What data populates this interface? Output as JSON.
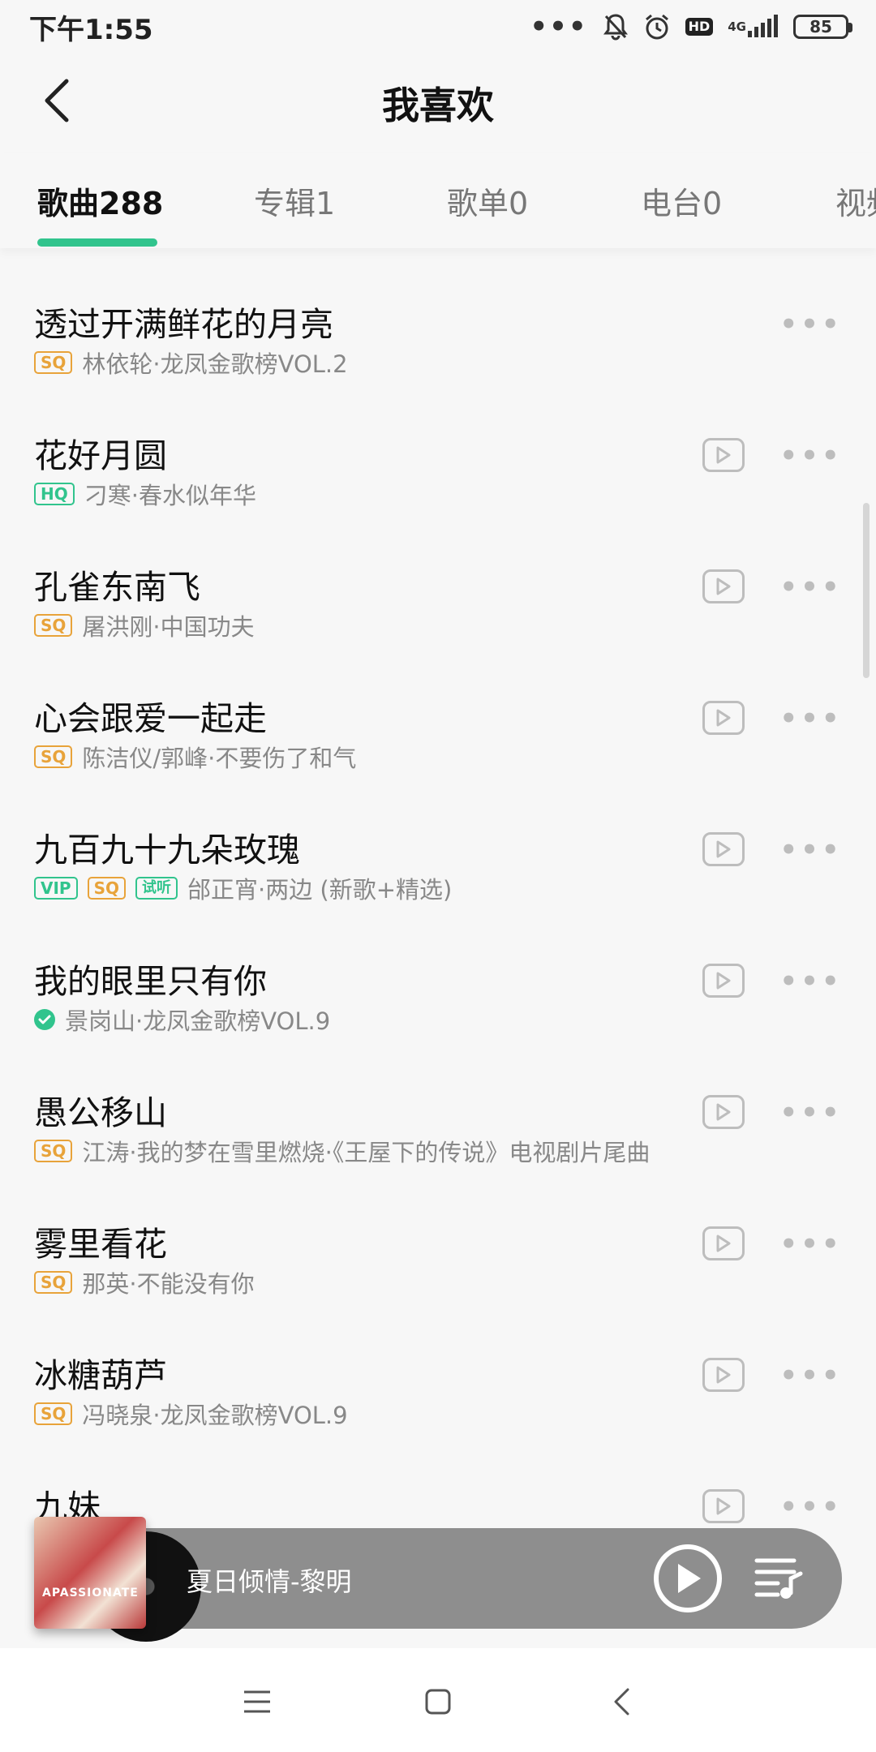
{
  "status_bar": {
    "time": "下午1:55",
    "network": "4G",
    "battery": "85",
    "icons": [
      "more-dots-icon",
      "bell-muted-icon",
      "alarm-icon",
      "hd-icon",
      "signal-icon",
      "battery-icon"
    ]
  },
  "header": {
    "title": "我喜欢",
    "back_icon": "chevron-left-icon"
  },
  "tabs": [
    {
      "label": "歌曲288",
      "active": true
    },
    {
      "label": "专辑1",
      "active": false
    },
    {
      "label": "歌单0",
      "active": false
    },
    {
      "label": "电台0",
      "active": false
    },
    {
      "label": "视频",
      "active": false
    }
  ],
  "songs": [
    {
      "title": "透过开满鲜花的月亮",
      "badges": [
        "SQ"
      ],
      "subtitle": "林依轮·龙凤金歌榜VOL.2",
      "has_mv": false
    },
    {
      "title": "花好月圆",
      "badges": [
        "HQ"
      ],
      "subtitle": "刁寒·春水似年华",
      "has_mv": true
    },
    {
      "title": "孔雀东南飞",
      "badges": [
        "SQ"
      ],
      "subtitle": "屠洪刚·中国功夫",
      "has_mv": true
    },
    {
      "title": "心会跟爱一起走",
      "badges": [
        "SQ"
      ],
      "subtitle": "陈洁仪/郭峰·不要伤了和气",
      "has_mv": true
    },
    {
      "title": "九百九十九朵玫瑰",
      "badges": [
        "VIP",
        "SQ",
        "试听"
      ],
      "subtitle": "邰正宵·两边 (新歌+精选)",
      "has_mv": true
    },
    {
      "title": "我的眼里只有你",
      "badges": [
        "downloaded"
      ],
      "subtitle": "景岗山·龙凤金歌榜VOL.9",
      "has_mv": true
    },
    {
      "title": "愚公移山",
      "badges": [
        "SQ"
      ],
      "subtitle": "江涛·我的梦在雪里燃烧·《王屋下的传说》电视剧片尾曲",
      "has_mv": true
    },
    {
      "title": "雾里看花",
      "badges": [
        "SQ"
      ],
      "subtitle": "那英·不能没有你",
      "has_mv": true
    },
    {
      "title": "冰糖葫芦",
      "badges": [
        "SQ"
      ],
      "subtitle": "冯晓泉·龙凤金歌榜VOL.9",
      "has_mv": true
    },
    {
      "title": "九妹",
      "badges": [],
      "subtitle": "",
      "has_mv": true
    }
  ],
  "player": {
    "now_playing": "夏日倾情-黎明",
    "cover_text": "APASSIONATE"
  },
  "colors": {
    "accent": "#31c48d",
    "sq_badge": "#e8a33a",
    "player_bg": "#8e8e8e"
  }
}
